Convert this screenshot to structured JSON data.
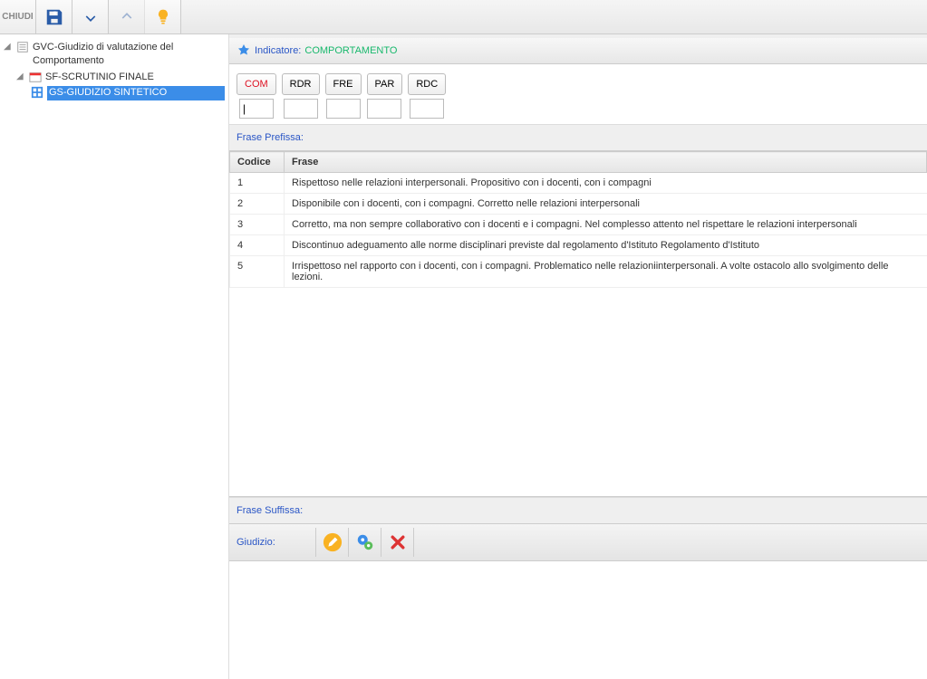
{
  "toolbar": {
    "close_label": "CHIUDI"
  },
  "tree": {
    "root": {
      "label": "GVC-Giudizio di valutazione del Comportamento"
    },
    "node1": {
      "label": "SF-SCRUTINIO FINALE"
    },
    "node2": {
      "label": "GS-GIUDIZIO SINTETICO"
    }
  },
  "indicatore": {
    "label": "Indicatore:",
    "value": "COMPORTAMENTO"
  },
  "codes": [
    {
      "label": "COM",
      "value": "",
      "active": true
    },
    {
      "label": "RDR",
      "value": ""
    },
    {
      "label": "FRE",
      "value": ""
    },
    {
      "label": "PAR",
      "value": ""
    },
    {
      "label": "RDC",
      "value": ""
    }
  ],
  "frase_prefissa_label": "Frase Prefissa:",
  "table": {
    "headers": {
      "codice": "Codice",
      "frase": "Frase"
    },
    "rows": [
      {
        "codice": "1",
        "frase": "Rispettoso nelle relazioni interpersonali. Propositivo con i docenti, con i compagni"
      },
      {
        "codice": "2",
        "frase": "Disponibile con i docenti, con i compagni. Corretto nelle relazioni interpersonali"
      },
      {
        "codice": "3",
        "frase": "Corretto, ma non sempre collaborativo con i docenti e i compagni. Nel complesso attento nel rispettare le relazioni interpersonali"
      },
      {
        "codice": "4",
        "frase": "Discontinuo adeguamento alle norme disciplinari previste dal regolamento d'Istituto Regolamento d'Istituto"
      },
      {
        "codice": "5",
        "frase": "Irrispettoso nel rapporto con i docenti, con i compagni. Problematico nelle relazioniinterpersonali. A volte ostacolo allo svolgimento delle lezioni."
      }
    ]
  },
  "frase_suffissa_label": "Frase Suffissa:",
  "giudizio_label": "Giudizio:"
}
